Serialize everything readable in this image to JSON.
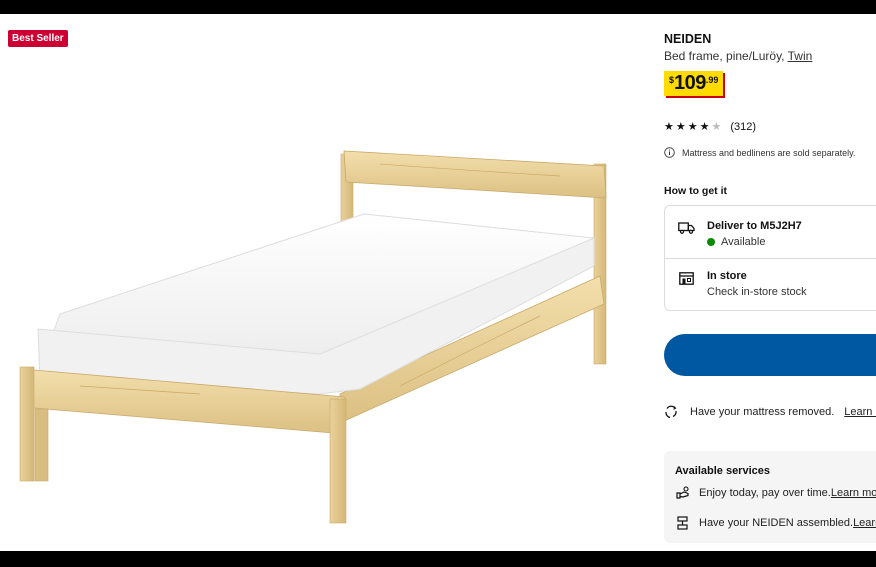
{
  "badge": "Best Seller",
  "product": {
    "name": "NEIDEN",
    "description": "Bed frame, pine/Luröy, ",
    "size_link": "Twin",
    "price": {
      "currency": "$",
      "integer": "109",
      "decimal": ".99"
    },
    "rating": {
      "stars": 4,
      "max": 5,
      "count": "(312)"
    },
    "note": "Mattress and bedlinens are sold separately."
  },
  "how_to_get": {
    "title": "How to get it",
    "delivery": {
      "title": "Deliver to M5J2H7",
      "status": "Available"
    },
    "store": {
      "title": "In store",
      "subtitle": "Check in-store stock"
    }
  },
  "removal": {
    "text": "Have your mattress removed.",
    "link": "Learn m"
  },
  "services": {
    "title": "Available services",
    "items": [
      {
        "text": "Enjoy today, pay over time. ",
        "link": "Learn mo"
      },
      {
        "text": "Have your NEIDEN assembled. ",
        "link": "Learn"
      }
    ]
  },
  "colors": {
    "accent_blue": "#0058a3",
    "price_yellow": "#ffdb00",
    "badge_red": "#cc0033",
    "available_green": "#0a8a00"
  }
}
